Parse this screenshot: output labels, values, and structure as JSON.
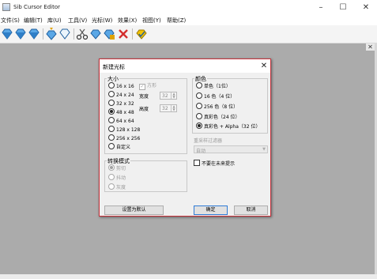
{
  "window": {
    "title": "Sib Cursor Editor",
    "min_icon": "minimize-icon",
    "max_icon": "maximize-icon",
    "close_icon": "close-icon",
    "min_glyph": "–",
    "max_glyph": "☐",
    "close_glyph": "✕"
  },
  "menu": [
    "文件(S)",
    "编辑(T)",
    "库(U)",
    "工具(V)",
    "光标(W)",
    "效果(X)",
    "视图(Y)",
    "帮助(Z)"
  ],
  "toolbar": {
    "icons": [
      "gem-icon",
      "gem-icon",
      "gem-icon",
      "gem-down-icon",
      "gem-outline-icon",
      "scissors-icon",
      "gem-icon",
      "gem-icon",
      "delete-icon",
      "gem-check-icon"
    ]
  },
  "workspace": {
    "close_glyph": "✕"
  },
  "dialog": {
    "title": "新建光标",
    "close_glyph": "✕",
    "size_group": {
      "title": "大小",
      "options": [
        "16 x 16",
        "24 x 24",
        "32 x 32",
        "48 x 48",
        "64 x 64",
        "128 x 128",
        "256 x 256",
        "自定义"
      ],
      "selected": 3,
      "square_label": "方形",
      "width_label": "宽度",
      "height_label": "高度",
      "width_value": "32",
      "height_value": "32"
    },
    "color_group": {
      "title": "颜色",
      "options": [
        "单色（1位）",
        "16 色（4 位）",
        "256 色（8 位）",
        "真彩色（24 位）",
        "真彩色 + Alpha（32 位）"
      ],
      "selected": 4
    },
    "filter": {
      "label": "重采样过滤器",
      "value": "自动"
    },
    "no_prompt_label": "不要在未来提示",
    "convert_group": {
      "title": "转换模式",
      "options": [
        "剪切",
        "抖动",
        "灰度"
      ],
      "selected": 0
    },
    "buttons": {
      "default": "设置为默认",
      "ok": "确定",
      "cancel": "取消"
    }
  }
}
